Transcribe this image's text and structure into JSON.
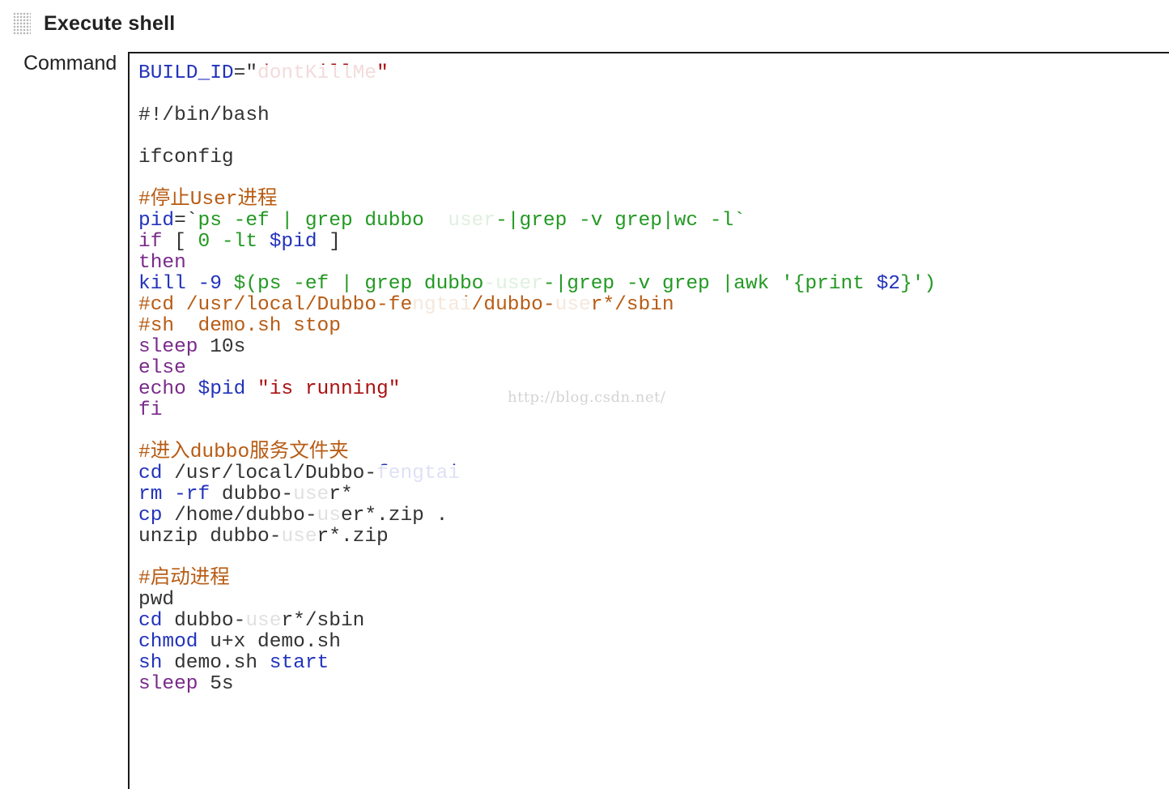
{
  "header": {
    "title": "Execute shell",
    "handle_icon": "drag-handle-icon"
  },
  "field": {
    "label": "Command"
  },
  "watermark": "http://blog.csdn.net/",
  "colors": {
    "blue": "#2233bb",
    "green": "#229922",
    "orange": "#b85c14",
    "purple": "#7a2a8a",
    "black": "#333333",
    "darkred": "#aa1111"
  },
  "code_lines": [
    {
      "segments": [
        {
          "t": "BUILD_ID",
          "c": "blue"
        },
        {
          "t": "=\"",
          "c": "black"
        },
        {
          "t": "dontKillMe",
          "c": "darkred",
          "mask": true
        },
        {
          "t": "\"",
          "c": "darkred"
        }
      ]
    },
    {
      "segments": []
    },
    {
      "segments": [
        {
          "t": "#!/bin/bash",
          "c": "black"
        }
      ]
    },
    {
      "segments": []
    },
    {
      "segments": [
        {
          "t": "ifconfig",
          "c": "black"
        }
      ]
    },
    {
      "segments": []
    },
    {
      "segments": [
        {
          "t": "#停止User进程",
          "c": "orange"
        }
      ]
    },
    {
      "segments": [
        {
          "t": "pid",
          "c": "blue"
        },
        {
          "t": "=`",
          "c": "black"
        },
        {
          "t": "ps -ef | grep dubbo  ",
          "c": "green"
        },
        {
          "t": "user",
          "c": "green",
          "mask": true
        },
        {
          "t": "-|grep -v grep|wc -l`",
          "c": "green"
        }
      ]
    },
    {
      "segments": [
        {
          "t": "if",
          "c": "purple"
        },
        {
          "t": " [ ",
          "c": "black"
        },
        {
          "t": "0 -lt ",
          "c": "green"
        },
        {
          "t": "$pid",
          "c": "blue"
        },
        {
          "t": " ]",
          "c": "black"
        }
      ]
    },
    {
      "segments": [
        {
          "t": "then",
          "c": "purple"
        }
      ]
    },
    {
      "segments": [
        {
          "t": "kill -9 ",
          "c": "blue"
        },
        {
          "t": "$(ps -ef | grep dubbo",
          "c": "green"
        },
        {
          "t": "-user",
          "c": "green",
          "mask": true
        },
        {
          "t": "-|grep -v grep |awk '{print ",
          "c": "green"
        },
        {
          "t": "$2",
          "c": "blue"
        },
        {
          "t": "}')",
          "c": "green"
        }
      ]
    },
    {
      "segments": [
        {
          "t": "#cd /usr/local/Dubbo-fe",
          "c": "orange"
        },
        {
          "t": "ngtai",
          "c": "orange",
          "mask": true
        },
        {
          "t": "/dubbo-",
          "c": "orange"
        },
        {
          "t": "use",
          "c": "orange",
          "mask": true
        },
        {
          "t": "r*/sbin",
          "c": "orange"
        }
      ]
    },
    {
      "segments": [
        {
          "t": "#sh  demo.sh stop",
          "c": "orange"
        }
      ]
    },
    {
      "segments": [
        {
          "t": "sleep",
          "c": "purple"
        },
        {
          "t": " 10s",
          "c": "black"
        }
      ]
    },
    {
      "segments": [
        {
          "t": "else",
          "c": "purple"
        }
      ]
    },
    {
      "segments": [
        {
          "t": "echo",
          "c": "purple"
        },
        {
          "t": " ",
          "c": "black"
        },
        {
          "t": "$pid",
          "c": "blue"
        },
        {
          "t": " ",
          "c": "black"
        },
        {
          "t": "\"is running\"",
          "c": "darkred"
        }
      ]
    },
    {
      "segments": [
        {
          "t": "fi",
          "c": "purple"
        }
      ]
    },
    {
      "segments": []
    },
    {
      "segments": [
        {
          "t": "#进入dubbo服务文件夹",
          "c": "orange"
        }
      ]
    },
    {
      "segments": [
        {
          "t": "cd",
          "c": "blue"
        },
        {
          "t": " /usr/local/Dubbo-",
          "c": "black"
        },
        {
          "t": "fengtai",
          "c": "blue",
          "mask": true
        }
      ]
    },
    {
      "segments": [
        {
          "t": "rm -rf",
          "c": "blue"
        },
        {
          "t": " dubbo-",
          "c": "black"
        },
        {
          "t": "use",
          "c": "black",
          "mask": true
        },
        {
          "t": "r*",
          "c": "black"
        }
      ]
    },
    {
      "segments": [
        {
          "t": "cp",
          "c": "blue"
        },
        {
          "t": " /home/dubbo-",
          "c": "black"
        },
        {
          "t": "us",
          "c": "black",
          "mask": true
        },
        {
          "t": "er*.zip .",
          "c": "black"
        }
      ]
    },
    {
      "segments": [
        {
          "t": "unzip",
          "c": "black"
        },
        {
          "t": " dubbo-",
          "c": "black"
        },
        {
          "t": "use",
          "c": "black",
          "mask": true
        },
        {
          "t": "r*.zip",
          "c": "black"
        }
      ]
    },
    {
      "segments": []
    },
    {
      "segments": [
        {
          "t": "#启动进程",
          "c": "orange"
        }
      ]
    },
    {
      "segments": [
        {
          "t": "pwd",
          "c": "black"
        }
      ]
    },
    {
      "segments": [
        {
          "t": "cd",
          "c": "blue"
        },
        {
          "t": " dubbo-",
          "c": "black"
        },
        {
          "t": "use",
          "c": "black",
          "mask": true
        },
        {
          "t": "r*/sbin",
          "c": "black"
        }
      ]
    },
    {
      "segments": [
        {
          "t": "chmod",
          "c": "blue"
        },
        {
          "t": " u+x demo.sh",
          "c": "black"
        }
      ]
    },
    {
      "segments": [
        {
          "t": "sh",
          "c": "blue"
        },
        {
          "t": " demo.sh ",
          "c": "black"
        },
        {
          "t": "start",
          "c": "blue"
        }
      ]
    },
    {
      "segments": [
        {
          "t": "sleep",
          "c": "purple"
        },
        {
          "t": " 5s",
          "c": "black"
        }
      ]
    }
  ]
}
